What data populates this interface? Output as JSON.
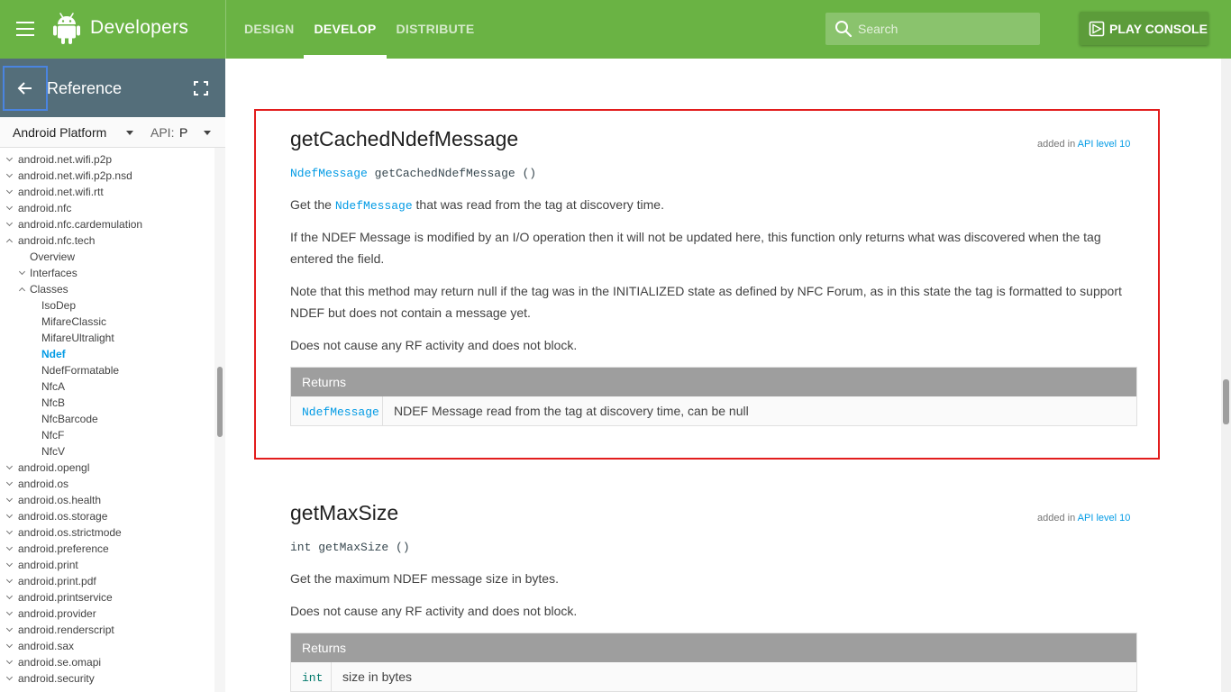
{
  "header": {
    "brand": "Developers",
    "tabs": [
      {
        "label": "DESIGN"
      },
      {
        "label": "DEVELOP"
      },
      {
        "label": "DISTRIBUTE"
      }
    ],
    "search_placeholder": "Search",
    "play_console_label": "PLAY CONSOLE"
  },
  "sidebar": {
    "title": "Reference",
    "platform_label": "Android Platform",
    "api_label": "API:",
    "api_value": "P",
    "tree": [
      "android.net.wifi.p2p",
      "android.net.wifi.p2p.nsd",
      "android.net.wifi.rtt",
      "android.nfc",
      "android.nfc.cardemulation",
      "android.nfc.tech",
      "Overview",
      "Interfaces",
      "Classes",
      "IsoDep",
      "MifareClassic",
      "MifareUltralight",
      "Ndef",
      "NdefFormatable",
      "NfcA",
      "NfcB",
      "NfcBarcode",
      "NfcF",
      "NfcV",
      "android.opengl",
      "android.os",
      "android.os.health",
      "android.os.storage",
      "android.os.strictmode",
      "android.preference",
      "android.print",
      "android.print.pdf",
      "android.printservice",
      "android.provider",
      "android.renderscript",
      "android.sax",
      "android.se.omapi",
      "android.security"
    ]
  },
  "method1": {
    "title": "getCachedNdefMessage",
    "added_prefix": "added in",
    "added_link": "API level 10",
    "sig_type": "NdefMessage",
    "sig_rest": "getCachedNdefMessage ()",
    "p1_pre": "Get the",
    "p1_code": "NdefMessage",
    "p1_post": "that was read from the tag at discovery time.",
    "p2": "If the NDEF Message is modified by an I/O operation then it will not be updated here, this function only returns what was discovered when the tag entered the field.",
    "p3": "Note that this method may return null if the tag was in the INITIALIZED state as defined by NFC Forum, as in this state the tag is formatted to support NDEF but does not contain a message yet.",
    "p4": "Does not cause any RF activity and does not block.",
    "returns_header": "Returns",
    "returns_type": "NdefMessage",
    "returns_desc": "NDEF Message read from the tag at discovery time, can be null"
  },
  "method2": {
    "title": "getMaxSize",
    "added_prefix": "added in",
    "added_link": "API level 10",
    "sig": "int getMaxSize ()",
    "p1": "Get the maximum NDEF message size in bytes.",
    "p2": "Does not cause any RF activity and does not block.",
    "returns_header": "Returns",
    "returns_type": "int",
    "returns_desc": "size in bytes"
  }
}
